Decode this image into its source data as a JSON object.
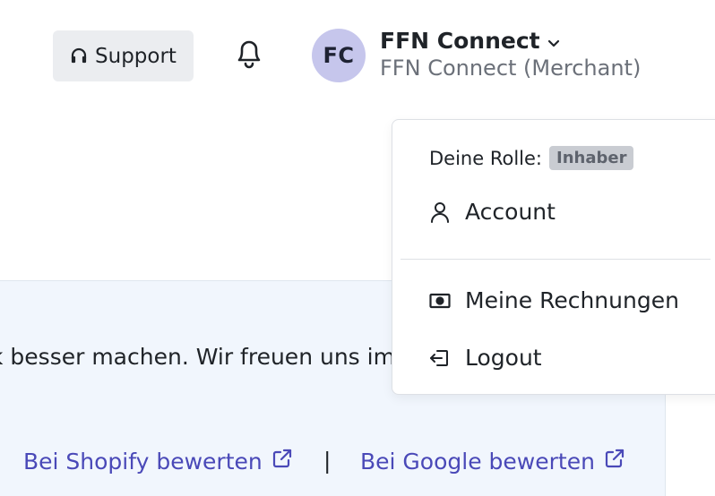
{
  "header": {
    "support_label": "Support",
    "avatar_initials": "FC",
    "account_name": "FFN Connect",
    "account_subtitle": "FFN Connect (Merchant)"
  },
  "dropdown": {
    "role_label": "Deine Rolle:",
    "role_value": "Inhaber",
    "items": [
      {
        "label": "Account",
        "icon": "user-icon"
      },
      {
        "label": "Meine Rechnungen",
        "icon": "invoice-icon"
      },
      {
        "label": "Logout",
        "icon": "logout-icon"
      }
    ]
  },
  "banner": {
    "text": "k besser machen. Wir freuen uns im",
    "shopify_link": "Bei Shopify bewerten",
    "separator": "|",
    "google_link": "Bei Google bewerten"
  },
  "colors": {
    "link": "#4a49b8",
    "avatar_bg": "#c6c6ec",
    "banner_bg": "#f1f6fd",
    "support_bg": "#ebedf0"
  }
}
